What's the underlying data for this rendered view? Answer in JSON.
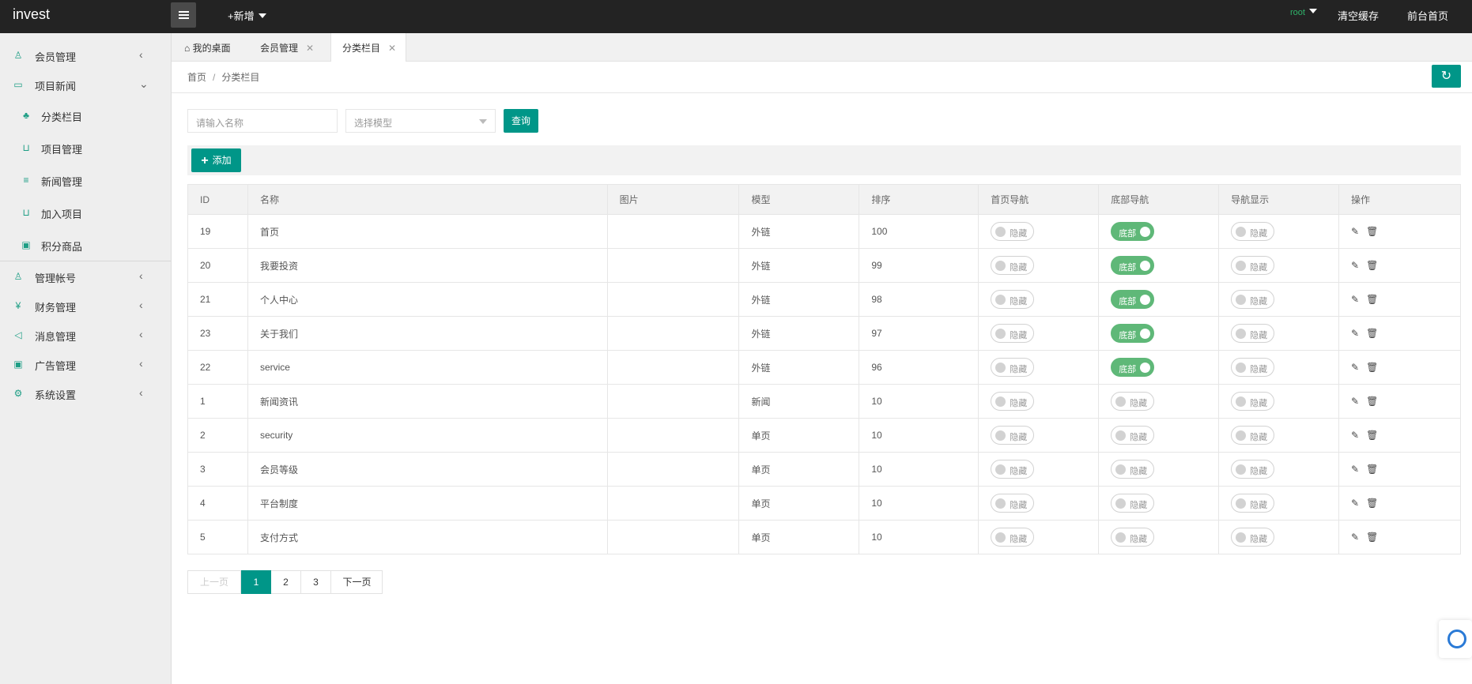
{
  "header": {
    "logo": "invest",
    "new_label": "+新增",
    "user": "root",
    "clear_cache": "清空缓存",
    "frontend": "前台首页"
  },
  "sidebar": {
    "items": [
      {
        "label": "会员管理",
        "icon": "user-icon",
        "arrow": "‹"
      },
      {
        "label": "项目新闻",
        "icon": "book-icon",
        "arrow": "⌄"
      },
      {
        "label": "分类栏目",
        "icon": "tree-icon"
      },
      {
        "label": "项目管理",
        "icon": "cart-icon"
      },
      {
        "label": "新闻管理",
        "icon": "doc-icon"
      },
      {
        "label": "加入项目",
        "icon": "cart-icon"
      },
      {
        "label": "积分商品",
        "icon": "image-icon"
      },
      {
        "label": "管理帐号",
        "icon": "users-icon",
        "arrow": "‹"
      },
      {
        "label": "财务管理",
        "icon": "yen-icon",
        "arrow": "‹"
      },
      {
        "label": "消息管理",
        "icon": "speaker-icon",
        "arrow": "‹"
      },
      {
        "label": "广告管理",
        "icon": "picture-icon",
        "arrow": "‹"
      },
      {
        "label": "系统设置",
        "icon": "gear-icon",
        "arrow": "‹"
      }
    ]
  },
  "tabs": [
    {
      "label": "我的桌面",
      "icon": "home-icon"
    },
    {
      "label": "会员管理",
      "close": "✕"
    },
    {
      "label": "分类栏目",
      "close": "✕"
    }
  ],
  "breadcrumb": {
    "home": "首页",
    "sep": "/",
    "current": "分类栏目"
  },
  "filters": {
    "name_placeholder": "请输入名称",
    "model_placeholder": "选择模型",
    "search_label": "查询"
  },
  "toolbar": {
    "add_label": "添加"
  },
  "table": {
    "columns": [
      "ID",
      "名称",
      "图片",
      "模型",
      "排序",
      "首页导航",
      "底部导航",
      "导航显示",
      "操作"
    ],
    "rows": [
      {
        "id": "19",
        "name": "首页",
        "model": "外链",
        "sort": "100",
        "home_nav": "隐藏",
        "bottom_nav": "底部",
        "bottom_on": true,
        "nav_show": "隐藏"
      },
      {
        "id": "20",
        "name": "我要投资",
        "model": "外链",
        "sort": "99",
        "home_nav": "隐藏",
        "bottom_nav": "底部",
        "bottom_on": true,
        "nav_show": "隐藏"
      },
      {
        "id": "21",
        "name": "个人中心",
        "model": "外链",
        "sort": "98",
        "home_nav": "隐藏",
        "bottom_nav": "底部",
        "bottom_on": true,
        "nav_show": "隐藏"
      },
      {
        "id": "23",
        "name": "关于我们",
        "model": "外链",
        "sort": "97",
        "home_nav": "隐藏",
        "bottom_nav": "底部",
        "bottom_on": true,
        "nav_show": "隐藏"
      },
      {
        "id": "22",
        "name": "service",
        "model": "外链",
        "sort": "96",
        "home_nav": "隐藏",
        "bottom_nav": "底部",
        "bottom_on": true,
        "nav_show": "隐藏"
      },
      {
        "id": "1",
        "name": "新闻资讯",
        "model": "新闻",
        "sort": "10",
        "home_nav": "隐藏",
        "bottom_nav": "隐藏",
        "bottom_on": false,
        "nav_show": "隐藏"
      },
      {
        "id": "2",
        "name": "security",
        "model": "单页",
        "sort": "10",
        "home_nav": "隐藏",
        "bottom_nav": "隐藏",
        "bottom_on": false,
        "nav_show": "隐藏"
      },
      {
        "id": "3",
        "name": "会员等级",
        "model": "单页",
        "sort": "10",
        "home_nav": "隐藏",
        "bottom_nav": "隐藏",
        "bottom_on": false,
        "nav_show": "隐藏"
      },
      {
        "id": "4",
        "name": "平台制度",
        "model": "单页",
        "sort": "10",
        "home_nav": "隐藏",
        "bottom_nav": "隐藏",
        "bottom_on": false,
        "nav_show": "隐藏"
      },
      {
        "id": "5",
        "name": "支付方式",
        "model": "单页",
        "sort": "10",
        "home_nav": "隐藏",
        "bottom_nav": "隐藏",
        "bottom_on": false,
        "nav_show": "隐藏"
      }
    ]
  },
  "pagination": {
    "prev": "上一页",
    "pages": [
      "1",
      "2",
      "3"
    ],
    "current": "1",
    "next": "下一页"
  },
  "colors": {
    "accent": "#009688",
    "switch_on": "#5fb878",
    "topbar": "#232323"
  }
}
